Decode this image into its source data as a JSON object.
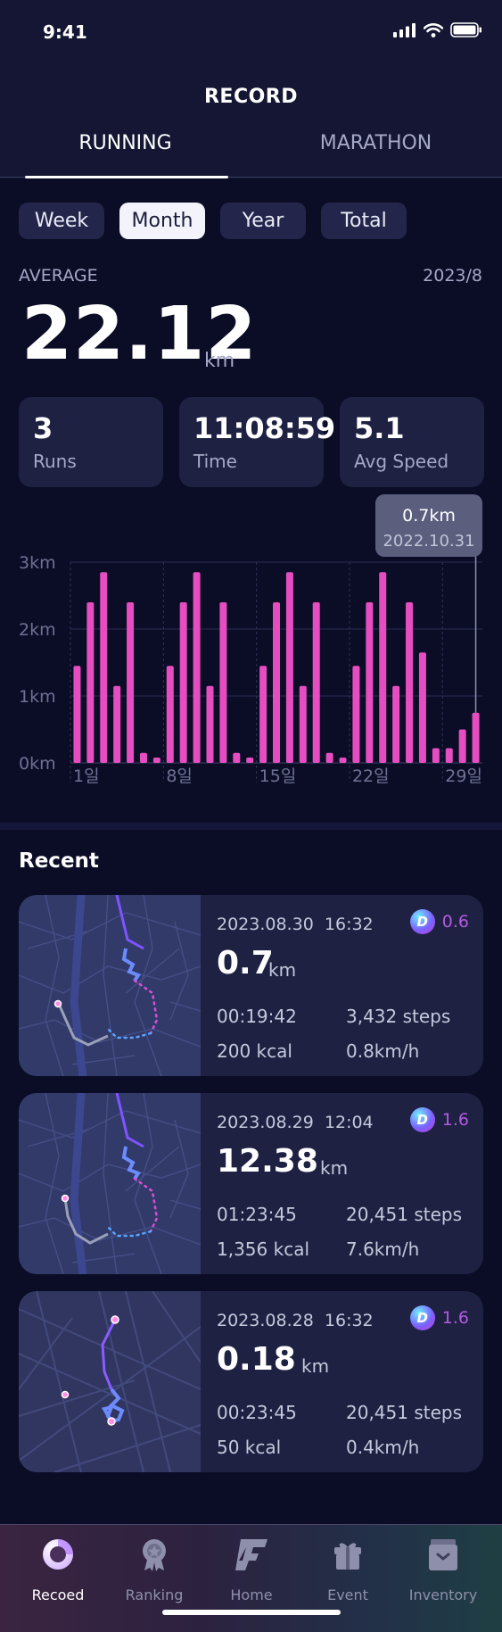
{
  "status_bar": {
    "time": "9:41"
  },
  "header": {
    "title": "RECORD"
  },
  "tabs": [
    {
      "label": "RUNNING",
      "active": true
    },
    {
      "label": "MARATHON",
      "active": false
    }
  ],
  "periods": [
    {
      "label": "Week",
      "selected": false
    },
    {
      "label": "Month",
      "selected": true
    },
    {
      "label": "Year",
      "selected": false
    },
    {
      "label": "Total",
      "selected": false
    }
  ],
  "average": {
    "label": "AVERAGE",
    "date": "2023/8",
    "value": "22.12",
    "unit": "km"
  },
  "stats": [
    {
      "value": "3",
      "label": "Runs"
    },
    {
      "value": "11:08:59",
      "label": "Time"
    },
    {
      "value": "5.1",
      "label": "Avg Speed"
    }
  ],
  "chart_data": {
    "type": "bar",
    "ylabels": [
      "0km",
      "1km",
      "2km",
      "3km"
    ],
    "ylim": [
      0,
      3
    ],
    "xticks": [
      {
        "label": "1일",
        "index": 0
      },
      {
        "label": "8일",
        "index": 7
      },
      {
        "label": "15일",
        "index": 14
      },
      {
        "label": "22일",
        "index": 21
      },
      {
        "label": "29일",
        "index": 28
      }
    ],
    "values": [
      1.45,
      2.4,
      2.85,
      1.15,
      2.4,
      0.15,
      0.08,
      1.45,
      2.4,
      2.85,
      1.15,
      2.4,
      0.15,
      0.08,
      1.45,
      2.4,
      2.85,
      1.15,
      2.4,
      0.15,
      0.08,
      1.45,
      2.4,
      2.85,
      1.15,
      2.4,
      1.65,
      0.22,
      0.22,
      0.5,
      0.75
    ],
    "tooltip": {
      "value": "0.7km",
      "date": "2022.10.31",
      "index": 30
    },
    "bar_color": "#e54dc1",
    "grid": true
  },
  "recent": {
    "title": "Recent",
    "items": [
      {
        "date": "2023.08.30",
        "time": "16:32",
        "token": "0.6",
        "distance": "0.7",
        "unit": "km",
        "duration": "00:19:42",
        "steps": "3,432 steps",
        "kcal": "200 kcal",
        "speed": "0.8km/h"
      },
      {
        "date": "2023.08.29",
        "time": "12:04",
        "token": "1.6",
        "distance": "12.38",
        "unit": "km",
        "duration": "01:23:45",
        "steps": "20,451 steps",
        "kcal": "1,356 kcal",
        "speed": "7.6km/h"
      },
      {
        "date": "2023.08.28",
        "time": "16:32",
        "token": "1.6",
        "distance": "0.18",
        "unit": "km",
        "duration": "00:23:45",
        "steps": "20,451 steps",
        "kcal": "50 kcal",
        "speed": "0.4km/h"
      }
    ]
  },
  "nav": [
    {
      "label": "Recoed",
      "icon": "record-icon",
      "active": true
    },
    {
      "label": "Ranking",
      "icon": "ranking-medal-icon",
      "active": false
    },
    {
      "label": "Home",
      "icon": "home-logo-icon",
      "active": false
    },
    {
      "label": "Event",
      "icon": "gift-icon",
      "active": false
    },
    {
      "label": "Inventory",
      "icon": "inventory-box-icon",
      "active": false
    }
  ]
}
